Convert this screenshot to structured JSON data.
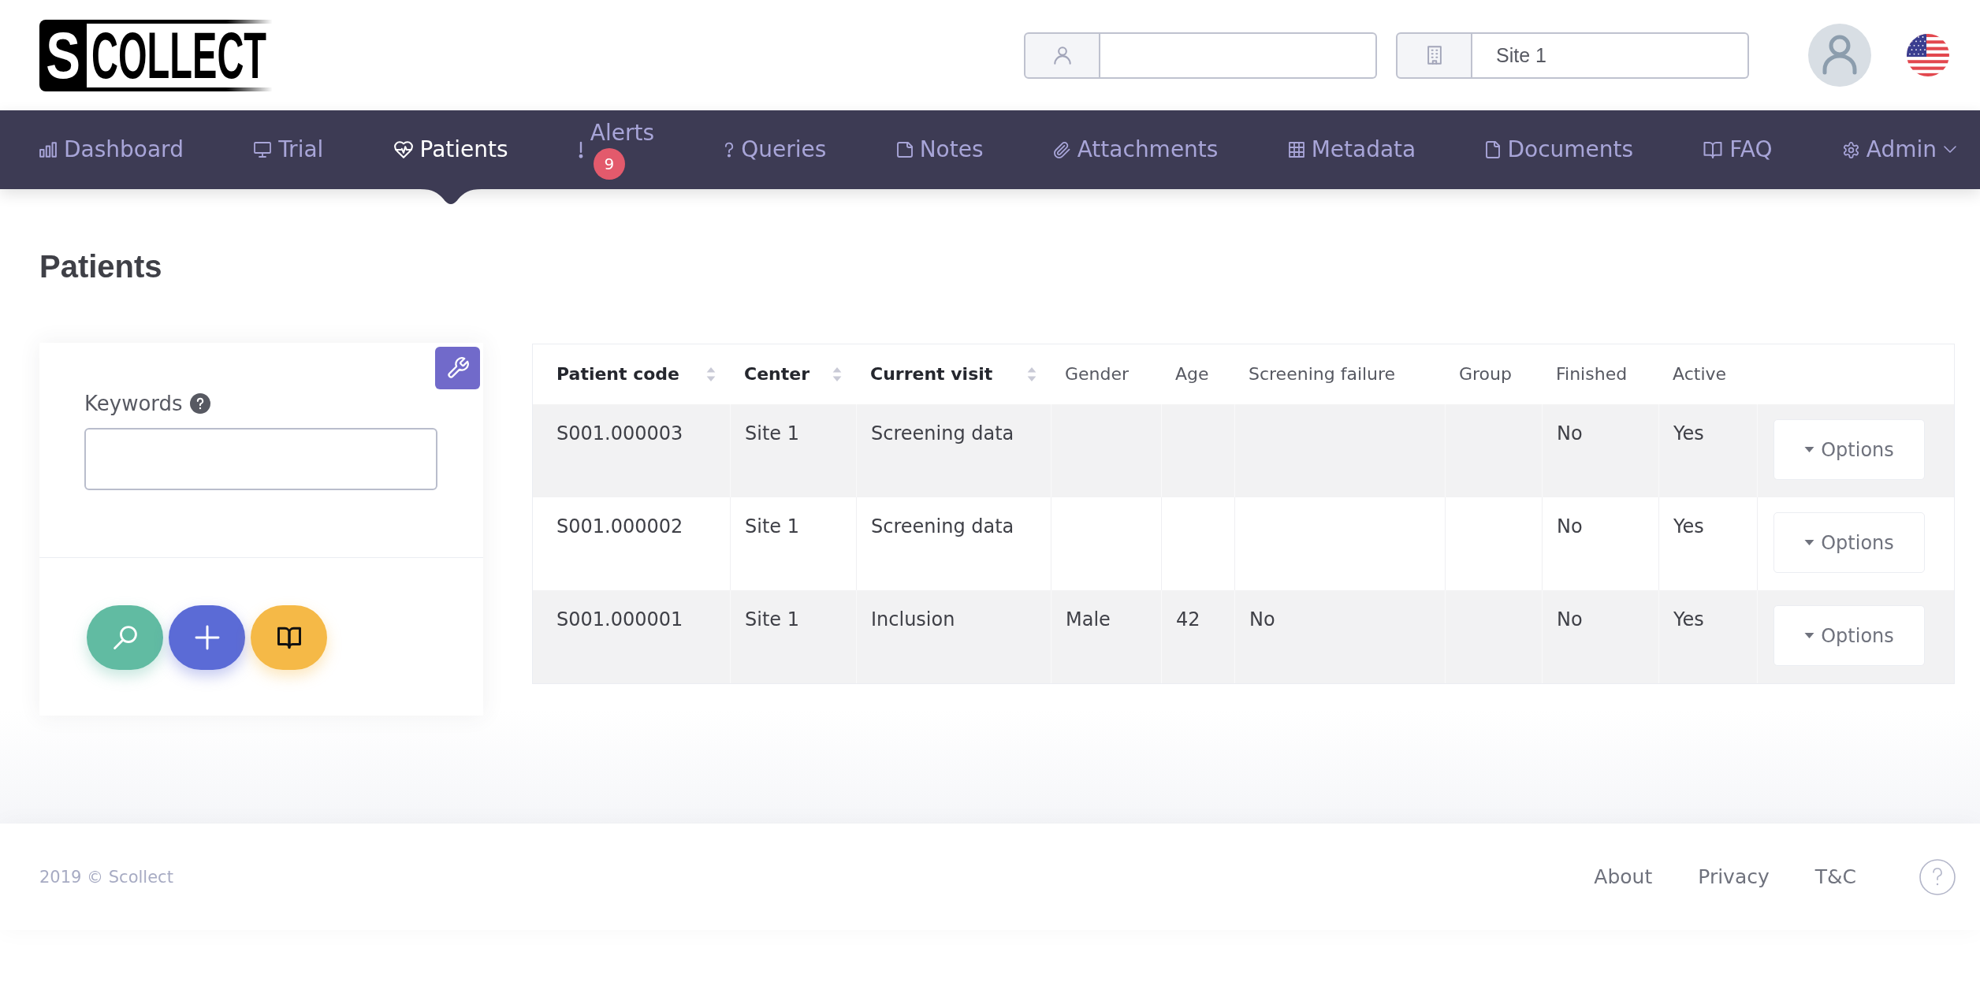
{
  "logo": {
    "letter": "S",
    "word": "COLLECT"
  },
  "header": {
    "site_field": {
      "value": "Site 1"
    }
  },
  "nav": [
    {
      "label": "Dashboard",
      "selected": false
    },
    {
      "label": "Trial",
      "selected": false
    },
    {
      "label": "Patients",
      "selected": true
    },
    {
      "label": "Alerts",
      "selected": false,
      "badge": "9"
    },
    {
      "label": "Queries",
      "selected": false
    },
    {
      "label": "Notes",
      "selected": false
    },
    {
      "label": "Attachments",
      "selected": false
    },
    {
      "label": "Metadata",
      "selected": false
    },
    {
      "label": "Documents",
      "selected": false
    },
    {
      "label": "FAQ",
      "selected": false
    },
    {
      "label": "Admin",
      "selected": false,
      "dropdown": true
    }
  ],
  "page_title": "Patients",
  "filter_panel": {
    "keywords_label": "Keywords"
  },
  "table": {
    "columns": [
      {
        "label": "Patient code",
        "sortable": true
      },
      {
        "label": "Center",
        "sortable": true
      },
      {
        "label": "Current visit",
        "sortable": true
      },
      {
        "label": "Gender",
        "sortable": false
      },
      {
        "label": "Age",
        "sortable": false
      },
      {
        "label": "Screening failure",
        "sortable": false
      },
      {
        "label": "Group",
        "sortable": false
      },
      {
        "label": "Finished",
        "sortable": false
      },
      {
        "label": "Active",
        "sortable": false
      }
    ],
    "rows": [
      {
        "cells": [
          "S001.000003",
          "Site 1",
          "Screening data",
          null,
          null,
          null,
          null,
          "No",
          "Yes"
        ],
        "action": "Options"
      },
      {
        "cells": [
          "S001.000002",
          "Site 1",
          "Screening data",
          null,
          null,
          null,
          null,
          "No",
          "Yes"
        ],
        "action": "Options"
      },
      {
        "cells": [
          "S001.000001",
          "Site 1",
          "Inclusion",
          "Male",
          "42",
          "No",
          null,
          "No",
          "Yes"
        ],
        "action": "Options"
      }
    ]
  },
  "footer": {
    "copyright": "2019 © Scollect",
    "links": [
      "About",
      "Privacy",
      "T&C"
    ]
  }
}
